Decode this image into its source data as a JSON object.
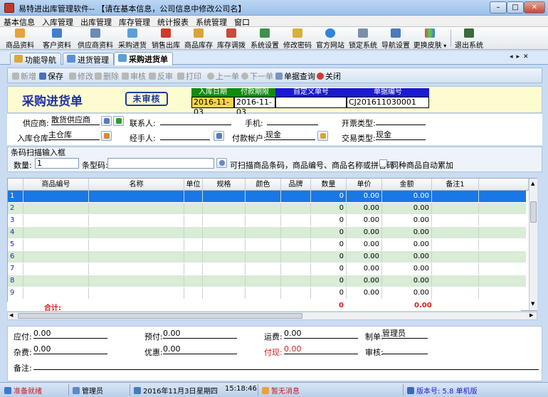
{
  "window": {
    "title": "易特进出库管理软件-- 【请在基本信息，公司信息中修改公司名】"
  },
  "menu": [
    "基本信息",
    "入库管理",
    "出库管理",
    "库存管理",
    "统计报表",
    "系统管理",
    "窗口"
  ],
  "toolbar": [
    "商品资料",
    "客户资料",
    "供应商资料",
    "采购进货",
    "销售出库",
    "商品库存",
    "库存调拨",
    "系统设置",
    "修改密码",
    "官方网站",
    "锁定系统",
    "导航设置",
    "更换皮肤",
    "退出系统"
  ],
  "tabs": [
    "功能导航",
    "进货管理",
    "采购进货单"
  ],
  "doc_tools": [
    "新增",
    "保存",
    "修改",
    "删除",
    "审核",
    "反审",
    "打印",
    "上一单",
    "下一单",
    "单据查询",
    "关闭"
  ],
  "form": {
    "title": "采购进货单",
    "status_stamp": "未审核",
    "header_fields": [
      {
        "label": "入库日期",
        "value": "2016-11-03"
      },
      {
        "label": "付款期限",
        "value": "2016-11-03"
      },
      {
        "label": "自定义单号",
        "value": ""
      },
      {
        "label": "单据编号",
        "value": "CJ201611030001"
      }
    ],
    "supplier_label": "供应商:",
    "supplier_value": "散货供应商",
    "contact_label": "联系人:",
    "contact_value": "",
    "phone_label": "手机:",
    "phone_value": "",
    "invoice_label": "开票类型:",
    "invoice_value": "",
    "warehouse_label": "入库仓库:",
    "warehouse_value": "主仓库",
    "handler_label": "经手人:",
    "handler_value": "",
    "account_label": "付款帐户:",
    "account_value": "现金",
    "trade_label": "交易类型:",
    "trade_value": "现金"
  },
  "scan": {
    "group_title": "条码扫描输入框",
    "qty_label": "数量:",
    "qty_value": "1",
    "barcode_label": "条型码:",
    "barcode_value": "",
    "hint": "可扫描商品条码，商品编号、商品名称或拼音码",
    "merge_label": "同种商品自动累加"
  },
  "grid": {
    "columns": [
      "商品编号",
      "名称",
      "单位",
      "规格",
      "颜色",
      "品牌",
      "数量",
      "单价",
      "金额",
      "备注1"
    ],
    "rows": [
      [
        "1",
        "",
        "",
        "",
        "",
        "",
        "",
        "0",
        "0.00",
        "0.00",
        ""
      ],
      [
        "2",
        "",
        "",
        "",
        "",
        "",
        "",
        "0",
        "0.00",
        "0.00",
        ""
      ],
      [
        "3",
        "",
        "",
        "",
        "",
        "",
        "",
        "0",
        "0.00",
        "0.00",
        ""
      ],
      [
        "4",
        "",
        "",
        "",
        "",
        "",
        "",
        "0",
        "0.00",
        "0.00",
        ""
      ],
      [
        "5",
        "",
        "",
        "",
        "",
        "",
        "",
        "0",
        "0.00",
        "0.00",
        ""
      ],
      [
        "6",
        "",
        "",
        "",
        "",
        "",
        "",
        "0",
        "0.00",
        "0.00",
        ""
      ],
      [
        "7",
        "",
        "",
        "",
        "",
        "",
        "",
        "0",
        "0.00",
        "0.00",
        ""
      ],
      [
        "8",
        "",
        "",
        "",
        "",
        "",
        "",
        "0",
        "0.00",
        "0.00",
        ""
      ],
      [
        "9",
        "",
        "",
        "",
        "",
        "",
        "",
        "0",
        "0.00",
        "0.00",
        ""
      ]
    ],
    "totals_label": "合计:",
    "total_qty": "0",
    "total_amount": "0.00"
  },
  "footer": {
    "payable_label": "应付:",
    "payable_value": "0.00",
    "prepaid_label": "预付:",
    "prepaid_value": "0.00",
    "freight_label": "运费:",
    "freight_value": "0.00",
    "maker_label": "制单:",
    "maker_value": "管理员",
    "misc_label": "杂费:",
    "misc_value": "0.00",
    "discount_label": "优惠:",
    "discount_value": "0.00",
    "paid_label": "付现:",
    "paid_value": "0.00",
    "auditor_label": "审核:",
    "auditor_value": "",
    "remark_label": "备注:",
    "remark_value": ""
  },
  "status": {
    "ready": "准备就绪",
    "user": "管理员",
    "date": "2016年11月3日",
    "weekday": "星期四",
    "time": "15:18:46",
    "message": "暂无消息",
    "version": "版本号: 5.8 单机版"
  },
  "colors": {
    "accent": "#1c2fa8",
    "green_header": "#118a11",
    "blue_header": "#1a1ad0",
    "row_alt": "#d8ecd6",
    "row_selected": "#1778e6",
    "total_red": "#d81c1c"
  }
}
